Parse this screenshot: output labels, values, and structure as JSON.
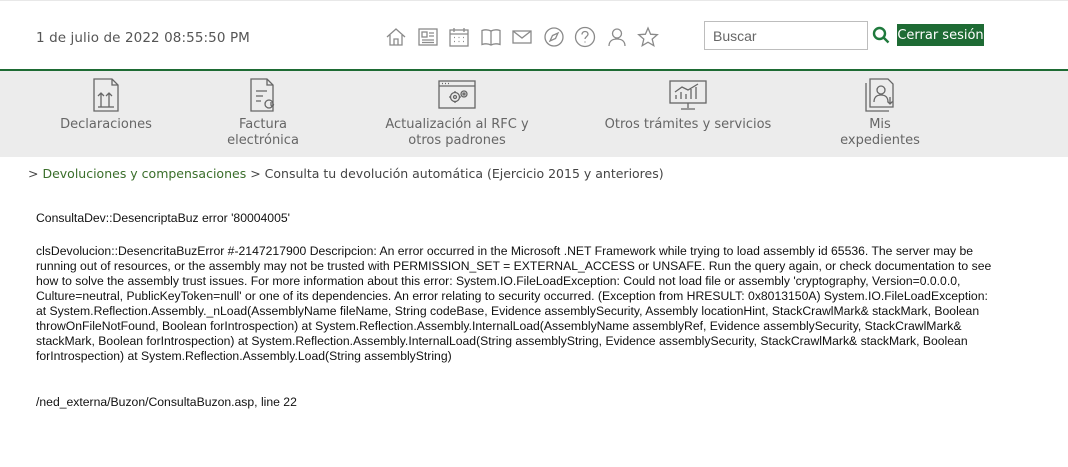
{
  "header": {
    "datetime": "1 de julio de 2022 08:55:50 PM",
    "icons": [
      "home-icon",
      "newspaper-icon",
      "calendar-icon",
      "book-icon",
      "mail-icon",
      "compass-icon",
      "help-icon",
      "user-icon",
      "star-icon"
    ],
    "search": {
      "placeholder": "Buscar",
      "value": ""
    },
    "logout_label": "Cerrar sesión"
  },
  "colors": {
    "accent": "#1e6b34",
    "link": "#3a6e2a",
    "nav_bg": "#ececec",
    "icon_gray": "#8a8a8a"
  },
  "nav": [
    {
      "label": "Declaraciones",
      "icon": "declarations-icon"
    },
    {
      "label": "Factura\nelectrónica",
      "icon": "invoice-icon"
    },
    {
      "label": "Actualización al RFC y\notros padrones",
      "icon": "rfc-update-icon"
    },
    {
      "label": "Otros trámites y servicios",
      "icon": "chart-screen-icon"
    },
    {
      "label": "Mis\nexpedientes",
      "icon": "files-icon"
    }
  ],
  "breadcrumb": {
    "link": "Devoluciones y compensaciones",
    "current": "Consulta tu devolución automática (Ejercicio 2015 y anteriores)"
  },
  "error": {
    "line1": "ConsultaDev::DesencriptaBuz error '80004005'",
    "detail": "clsDevolucion::DesencritaBuzError #-2147217900 Descripcion: An error occurred in the Microsoft .NET Framework while trying to load assembly id 65536. The server may be running out of resources, or the assembly may not be trusted with PERMISSION_SET = EXTERNAL_ACCESS or UNSAFE. Run the query again, or check documentation to see how to solve the assembly trust issues. For more information about this error: System.IO.FileLoadException: Could not load file or assembly 'cryptography, Version=0.0.0.0, Culture=neutral, PublicKeyToken=null' or one of its dependencies. An error relating to security occurred. (Exception from HRESULT: 0x8013150A) System.IO.FileLoadException: at System.Reflection.Assembly._nLoad(AssemblyName fileName, String codeBase, Evidence assemblySecurity, Assembly locationHint, StackCrawlMark& stackMark, Boolean throwOnFileNotFound, Boolean forIntrospection) at System.Reflection.Assembly.InternalLoad(AssemblyName assemblyRef, Evidence assemblySecurity, StackCrawlMark& stackMark, Boolean forIntrospection) at System.Reflection.Assembly.InternalLoad(String assemblyString, Evidence assemblySecurity, StackCrawlMark& stackMark, Boolean forIntrospection) at System.Reflection.Assembly.Load(String assemblyString)",
    "location": "/ned_externa/Buzon/ConsultaBuzon.asp, line 22"
  }
}
